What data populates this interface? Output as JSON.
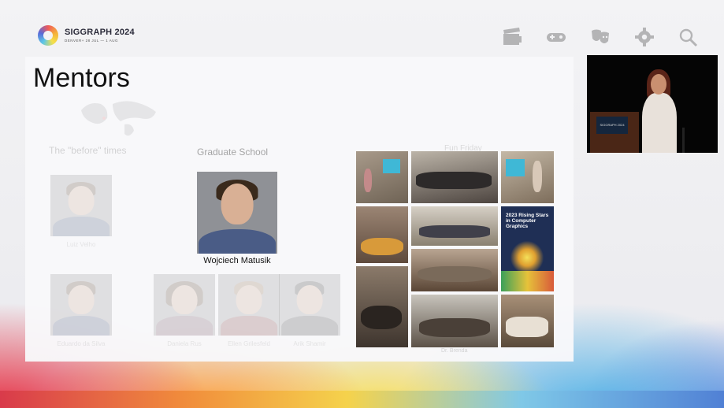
{
  "header": {
    "logo_title": "SIGGRAPH 2024",
    "logo_subtitle": "DENVER+ 28 JUL — 1 AUG",
    "icons": [
      "clapperboard-icon",
      "gamepad-icon",
      "masks-icon",
      "gear-icon",
      "search-icon"
    ]
  },
  "slide": {
    "title": "Mentors",
    "sections": {
      "before": "The \"before\" times",
      "grad": "Graduate School",
      "fun": "Fun Friday"
    },
    "people": {
      "top_left": "Luiz Velho",
      "featured": "Wojciech Matusik",
      "bottom_left": "Eduardo da Silva",
      "grad_1": "Daniela Rus",
      "grad_2": "Ellen Grilesfeld",
      "grad_3": "Arik Shamir"
    },
    "collage_caption": "Dr. Brenda",
    "poster_text": "2023 Rising Stars in Computer Graphics"
  },
  "video": {
    "podium_text": "SIGGRAPH 2024"
  },
  "colors": {
    "accent_red": "#d83a4a",
    "accent_orange": "#f08a3a",
    "accent_yellow": "#f5d24a",
    "accent_blue": "#4f7fd4"
  }
}
